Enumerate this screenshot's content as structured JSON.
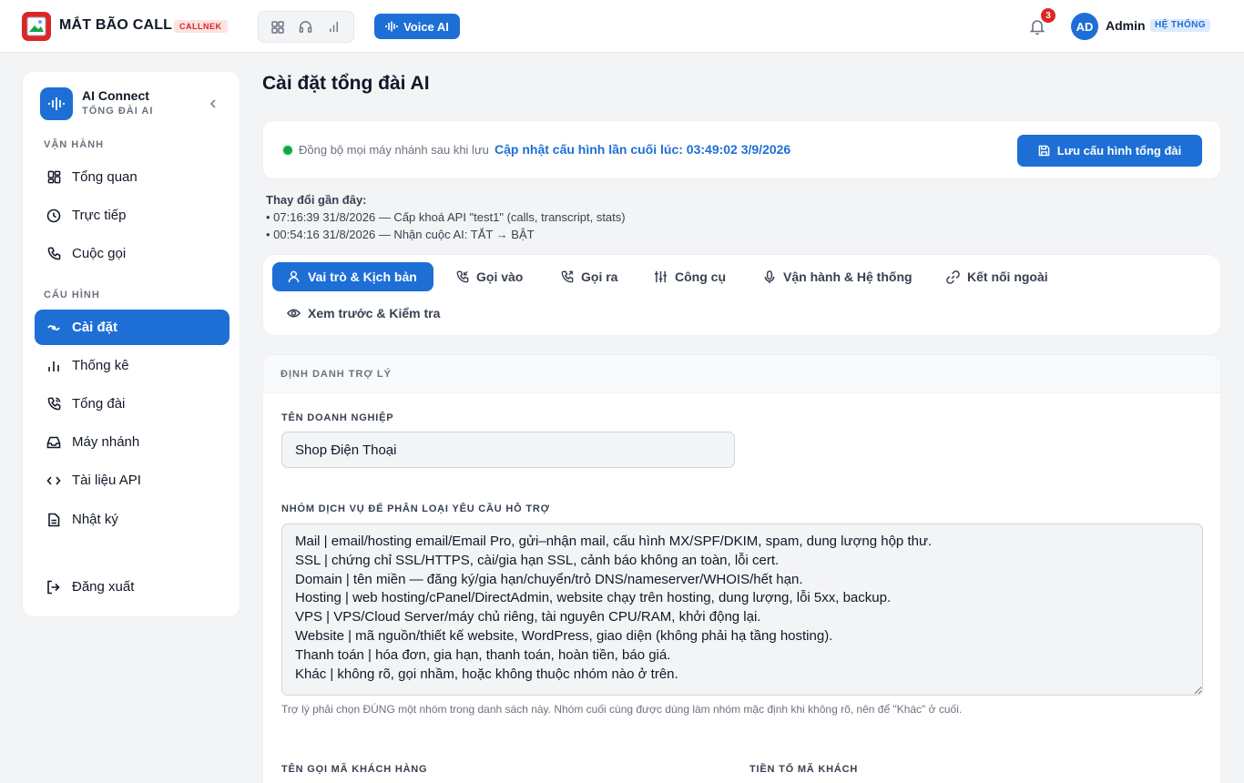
{
  "header": {
    "brand": "MẮT BÃO CALL",
    "brand_badge": "CALLNEK",
    "voice_ai_label": "Voice AI",
    "notification_count": "3",
    "avatar_initials": "AD",
    "user_name": "Admin",
    "user_role": "HỆ THỐNG",
    "mode_icons": [
      "grid-icon",
      "headset-icon",
      "bar-chart-icon"
    ]
  },
  "sidebar": {
    "title": "AI Connect",
    "subtitle": "TỔNG ĐÀI AI",
    "sections": {
      "operations": "VẬN HÀNH",
      "config": "CẤU HÌNH"
    },
    "items": [
      {
        "label": "Tổng quan",
        "icon": "dashboard-icon"
      },
      {
        "label": "Trực tiếp",
        "icon": "clock-icon"
      },
      {
        "label": "Cuộc gọi",
        "icon": "phone-icon"
      },
      {
        "label": "Cài đặt",
        "icon": "settings-icon",
        "active": true
      },
      {
        "label": "Thống kê",
        "icon": "bar-chart-icon"
      },
      {
        "label": "Tổng đài",
        "icon": "phone-call-icon"
      },
      {
        "label": "Máy nhánh",
        "icon": "inbox-icon"
      },
      {
        "label": "Tài liệu API",
        "icon": "code-icon"
      },
      {
        "label": "Nhật ký",
        "icon": "file-icon"
      },
      {
        "label": "Đăng xuất",
        "icon": "logout-icon"
      }
    ]
  },
  "main": {
    "title": "Cài đặt tổng đài AI",
    "sync_text": "Đồng bộ mọi máy nhánh sau khi lưu",
    "last_updated": "Cập nhật cấu hình lần cuối lúc: 03:49:02 3/9/2026",
    "save_label": "Lưu cấu hình tổng đài",
    "recent_label": "Thay đổi gần đây:",
    "recent_changes": [
      "• 07:16:39 31/8/2026 — Cấp khoá API \"test1\" (calls, transcript, stats)",
      "• 00:54:16 31/8/2026 — Nhận cuộc AI: TẮT → BẬT"
    ],
    "tabs": [
      {
        "label": "Vai trò & Kịch bản",
        "icon": "user-icon",
        "active": true
      },
      {
        "label": "Gọi vào",
        "icon": "phone-incoming-icon"
      },
      {
        "label": "Gọi ra",
        "icon": "phone-outgoing-icon"
      },
      {
        "label": "Công cụ",
        "icon": "sliders-icon"
      },
      {
        "label": "Vận hành & Hệ thống",
        "icon": "mic-icon"
      },
      {
        "label": "Kết nối ngoài",
        "icon": "link-icon"
      },
      {
        "label": "Xem trước & Kiểm tra",
        "icon": "eye-icon"
      }
    ],
    "section_header": "ĐỊNH DANH TRỢ LÝ",
    "company_label": "TÊN DOANH NGHIỆP",
    "company_value": "Shop Điện Thoại",
    "service_groups_label": "NHÓM DỊCH VỤ ĐỂ PHÂN LOẠI YÊU CẦU HỖ TRỢ",
    "service_groups_value": "Mail | email/hosting email/Email Pro, gửi–nhận mail, cấu hình MX/SPF/DKIM, spam, dung lượng hộp thư.\nSSL | chứng chỉ SSL/HTTPS, cài/gia hạn SSL, cảnh báo không an toàn, lỗi cert.\nDomain | tên miền — đăng ký/gia hạn/chuyển/trỏ DNS/nameserver/WHOIS/hết hạn.\nHosting | web hosting/cPanel/DirectAdmin, website chạy trên hosting, dung lượng, lỗi 5xx, backup.\nVPS | VPS/Cloud Server/máy chủ riêng, tài nguyên CPU/RAM, khởi động lại.\nWebsite | mã nguồn/thiết kế website, WordPress, giao diện (không phải hạ tầng hosting).\nThanh toán | hóa đơn, gia hạn, thanh toán, hoàn tiền, báo giá.\nKhác | không rõ, gọi nhầm, hoặc không thuộc nhóm nào ở trên.",
    "service_groups_help": "Trợ lý phải chọn ĐÚNG một nhóm trong danh sách này. Nhóm cuối cùng được dùng làm nhóm mặc định khi không rõ, nên để \"Khác\" ở cuối.",
    "customer_code_label": "TÊN GỌI MÃ KHÁCH HÀNG",
    "customer_prefix_label": "TIỀN TỐ MÃ KHÁCH"
  },
  "colors": {
    "accent": "#1d6fd6",
    "brand_red": "#dc2626",
    "success": "#16a34a"
  }
}
